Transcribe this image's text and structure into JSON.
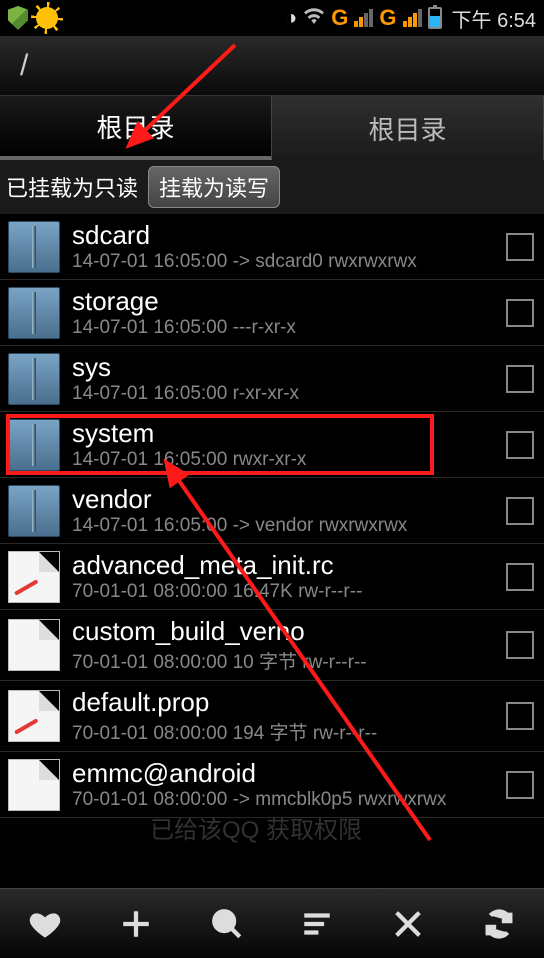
{
  "status": {
    "time": "下午 6:54",
    "network1": "G",
    "network2": "G"
  },
  "path": "/",
  "tabs": {
    "left": "根目录",
    "right": "根目录"
  },
  "mount": {
    "status": "已挂载为只读",
    "button": "挂载为读写"
  },
  "files": [
    {
      "name": "sdcard",
      "meta": "14-07-01 16:05:00  -> sdcard0  rwxrwxrwx",
      "type": "folder",
      "pencil": false,
      "highlight": false
    },
    {
      "name": "storage",
      "meta": "14-07-01 16:05:00  ---r-xr-x",
      "type": "folder",
      "pencil": false,
      "highlight": false
    },
    {
      "name": "sys",
      "meta": "14-07-01 16:05:00  r-xr-xr-x",
      "type": "folder",
      "pencil": false,
      "highlight": false
    },
    {
      "name": "system",
      "meta": "14-07-01 16:05:00  rwxr-xr-x",
      "type": "folder",
      "pencil": false,
      "highlight": true
    },
    {
      "name": "vendor",
      "meta": "14-07-01 16:05:00  -> vendor  rwxrwxrwx",
      "type": "folder",
      "pencil": false,
      "highlight": false
    },
    {
      "name": "advanced_meta_init.rc",
      "meta": "70-01-01 08:00:00  16.47K  rw-r--r--",
      "type": "file",
      "pencil": true,
      "highlight": false
    },
    {
      "name": "custom_build_verno",
      "meta": "70-01-01 08:00:00  10 字节  rw-r--r--",
      "type": "file",
      "pencil": false,
      "highlight": false
    },
    {
      "name": "default.prop",
      "meta": "70-01-01 08:00:00  194 字节  rw-r--r--",
      "type": "file",
      "pencil": true,
      "highlight": false
    },
    {
      "name": "emmc@android",
      "meta": "70-01-01 08:00:00  -> mmcblk0p5  rwxrwxrwx",
      "type": "file",
      "pencil": false,
      "highlight": false
    }
  ],
  "watermark": "已给该QQ 获取权限"
}
